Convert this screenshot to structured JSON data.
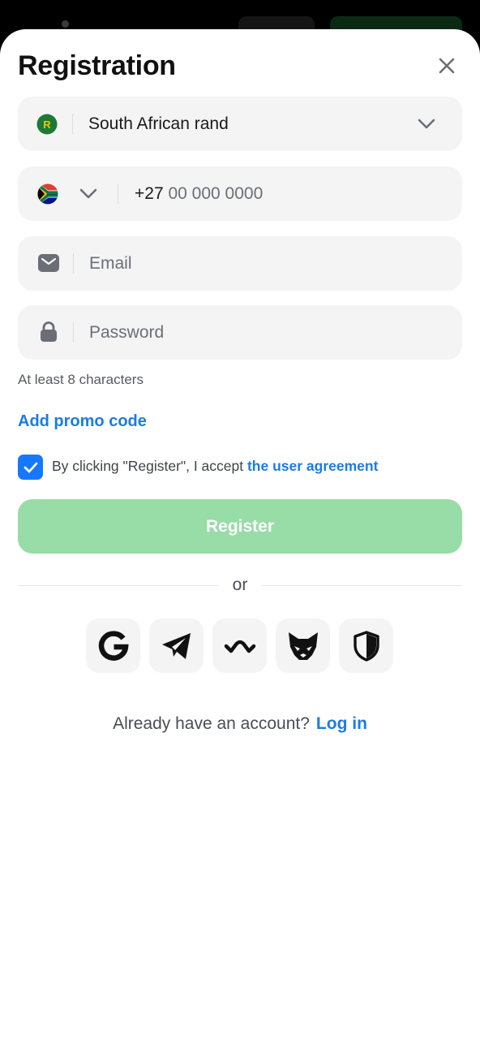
{
  "header": {
    "title": "Registration"
  },
  "currency": {
    "badge": "R",
    "value": "South African rand"
  },
  "phone": {
    "prefix": "+27",
    "placeholder": "00 000 0000"
  },
  "email": {
    "placeholder": "Email"
  },
  "password": {
    "placeholder": "Password",
    "hint": "At least 8 characters"
  },
  "promo": {
    "label": "Add promo code"
  },
  "agreement": {
    "checked": true,
    "text": "By clicking \"Register\", I accept ",
    "link": "the user agreement"
  },
  "register": {
    "label": "Register"
  },
  "divider": {
    "label": "or"
  },
  "social": [
    "google-icon",
    "telegram-icon",
    "walletconnect-icon",
    "metamask-fox-icon",
    "shield-icon"
  ],
  "footer": {
    "question": "Already have an account?",
    "link": "Log in"
  },
  "colors": {
    "accent": "#1b7ce4",
    "register_disabled": "#98dca8",
    "checkbox": "#1677ff"
  }
}
